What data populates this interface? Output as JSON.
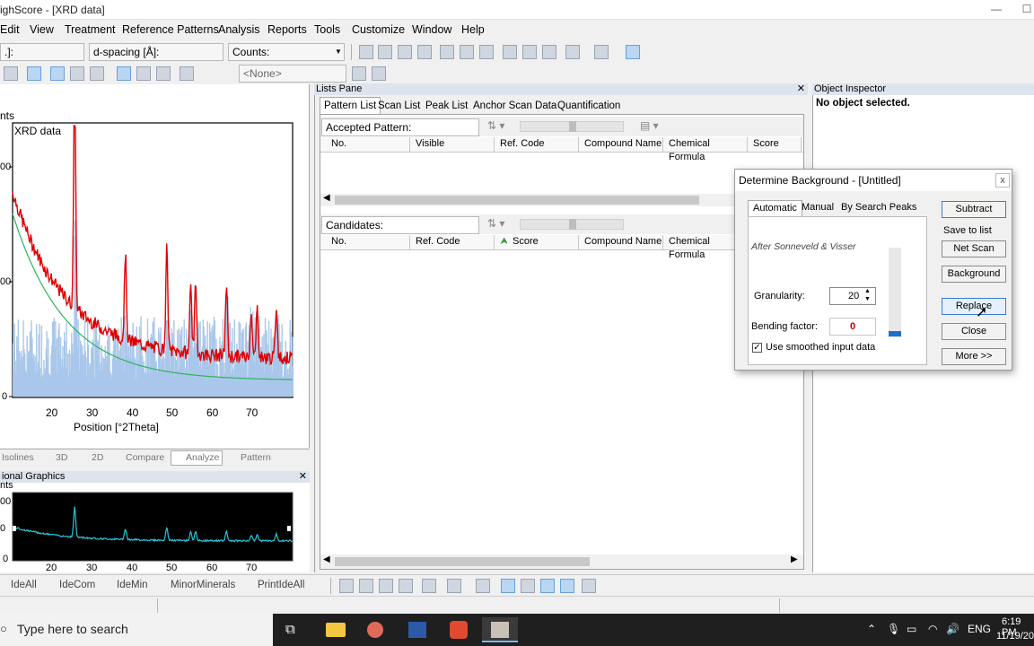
{
  "window": {
    "title": "ighScore - [XRD data]"
  },
  "menu": [
    "Edit",
    "View",
    "Treatment",
    "Reference Patterns",
    "Analysis",
    "Reports",
    "Tools",
    "Customize",
    "Window",
    "Help"
  ],
  "toolbar": {
    "field1": ".]:",
    "field2": "d-spacing [Å]:",
    "field3": "Counts:",
    "field4": "<None>"
  },
  "main_plot": {
    "left_label": "nts",
    "title": "XRD data",
    "xlabel": "Position [°2Theta]",
    "xticks": [
      "20",
      "30",
      "40",
      "50",
      "60",
      "70"
    ],
    "yticks": [
      "00",
      "00",
      "0"
    ]
  },
  "view_tabs": [
    "Isolines",
    "3D",
    "2D",
    "Compare",
    "Analyze",
    "Pattern"
  ],
  "additional_graphics": {
    "header": "ional Graphics",
    "left_label": "nts",
    "yticks": [
      "00",
      "0",
      "0"
    ],
    "xticks": [
      "20",
      "30",
      "40",
      "50",
      "60",
      "70"
    ]
  },
  "lists_pane": {
    "header": "Lists Pane",
    "tabs": [
      "Pattern List",
      "Scan List",
      "Peak List",
      "Anchor Scan Data",
      "Quantification"
    ],
    "accepted_label": "Accepted Pattern:",
    "accepted_columns": [
      "No.",
      "Visible",
      "Ref. Code",
      "Compound Name",
      "Chemical Formula",
      "Score"
    ],
    "candidates_label": "Candidates:",
    "candidate_columns": [
      "No.",
      "Ref. Code",
      "Score",
      "Compound Name",
      "Chemical Formula"
    ]
  },
  "object_inspector": {
    "header": "Object Inspector",
    "message": "No object selected."
  },
  "dialog": {
    "title": "Determine Background - [Untitled]",
    "close": "x",
    "tabs": [
      "Automatic",
      "Manual",
      "By Search Peaks"
    ],
    "method": "After Sonneveld & Visser",
    "granularity_label": "Granularity:",
    "granularity_value": "20",
    "bending_label": "Bending factor:",
    "bending_value": "0",
    "checkbox_label": "Use smoothed input data",
    "checkbox_checked": true,
    "subtract": "Subtract",
    "save_to_list": "Save to list",
    "net_scan": "Net Scan",
    "background": "Background",
    "replace": "Replace",
    "close_btn": "Close",
    "more": "More >>"
  },
  "bottom_toolbar": [
    "IdeAll",
    "IdeCom",
    "IdeMin",
    "MinorMinerals",
    "PrintIdeAll"
  ],
  "taskbar": {
    "search_placeholder": "Type here to search",
    "lang": "ENG",
    "time": "6:19 PM",
    "date": "11/19/20"
  },
  "colors": {
    "accent": "#3a7bd5",
    "pattern_red": "#e00000",
    "background_green": "#2db35d",
    "raw_blue": "#a9c7ea",
    "overview_cyan": "#26c6da"
  }
}
